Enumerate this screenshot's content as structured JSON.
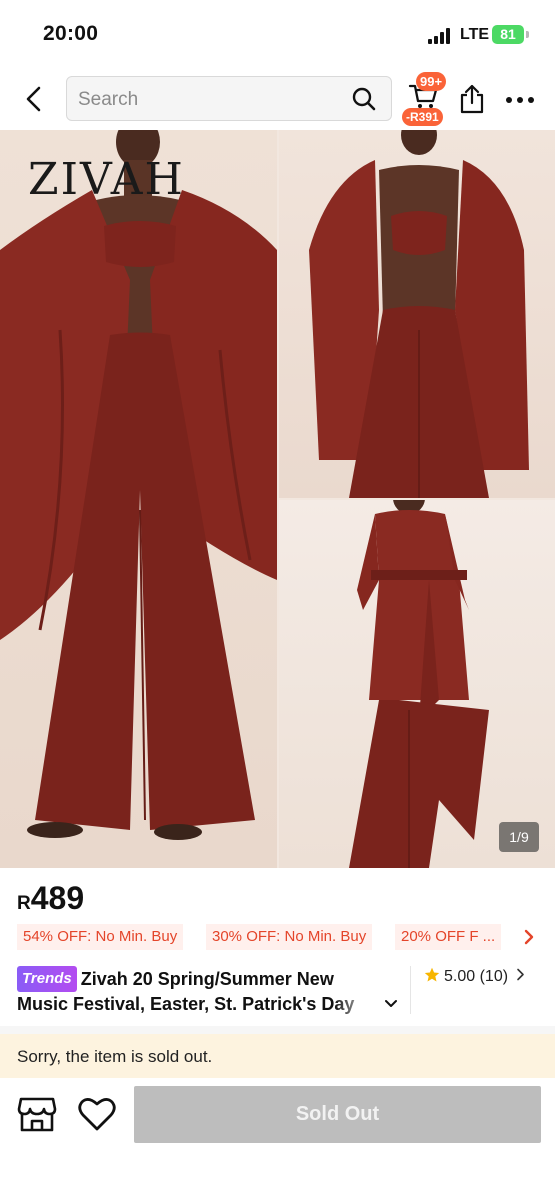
{
  "status_bar": {
    "time": "20:00",
    "network": "LTE",
    "battery": "81"
  },
  "nav": {
    "search_placeholder": "Search",
    "cart_badge": "99+",
    "cart_discount": "-R391"
  },
  "gallery": {
    "brand_logo": "ZIVAH",
    "page_indicator": "1/9"
  },
  "product": {
    "price_currency": "R",
    "price_value": "489",
    "promos": [
      "54% OFF: No Min. Buy",
      "30% OFF: No Min. Buy",
      "20% OFF F ..."
    ],
    "trends_badge": "Trends",
    "title_line1": "Zivah 20  Spring/Summer New",
    "title_line2": "Music Festival, Easter, St. Patrick's Day",
    "rating": "5.00",
    "rating_count": "(10)"
  },
  "notice": {
    "text": "Sorry, the item is sold out."
  },
  "bottom_bar": {
    "cta_label": "Sold Out"
  },
  "colors": {
    "accent": "#fa6338",
    "promo_text": "#e4452a",
    "promo_bg": "#fff0ed",
    "garment": "#8e2a22",
    "sold_out_bg": "#bdbdbd",
    "notice_bg": "#fdf3df",
    "battery": "#4cd964",
    "star": "#f7b500"
  }
}
